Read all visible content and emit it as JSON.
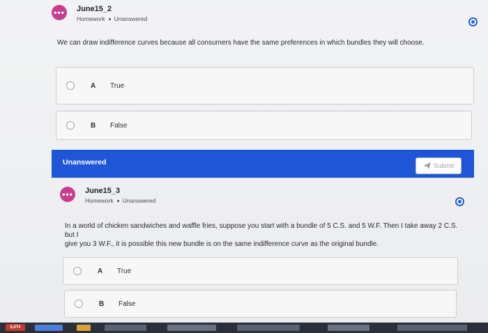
{
  "questions": [
    {
      "title": "June15_2",
      "homework_label": "Homework",
      "status": "Unanswered",
      "avatar_glyph": "•••",
      "prompt": "We can draw indifference curves because all consumers have the same preferences in which bundles they will choose.",
      "choices": [
        {
          "letter": "A",
          "text": "True"
        },
        {
          "letter": "B",
          "text": "False"
        }
      ]
    },
    {
      "title": "June15_3",
      "homework_label": "Homework",
      "status": "Unanswered",
      "avatar_glyph": "•••",
      "prompt_line1": "In a world of chicken sandwiches and waffle fries, suppose you start with a bundle of 5 C.S. and 5 W.F. Then I take away 2 C.S. but I",
      "prompt_line2": "give you 3 W.F., it is possible this new bundle is on the same indifference curve as the original bundle.",
      "choices": [
        {
          "letter": "A",
          "text": "True"
        },
        {
          "letter": "B",
          "text": "False"
        }
      ]
    }
  ],
  "status_bar": {
    "label": "Unanswered",
    "submit_label": "Submit"
  },
  "taskbar": {
    "badge": "5,074"
  },
  "colors": {
    "accent": "#1f56d8",
    "avatar": "#c63e8f",
    "flag": "#1f5ee0"
  }
}
